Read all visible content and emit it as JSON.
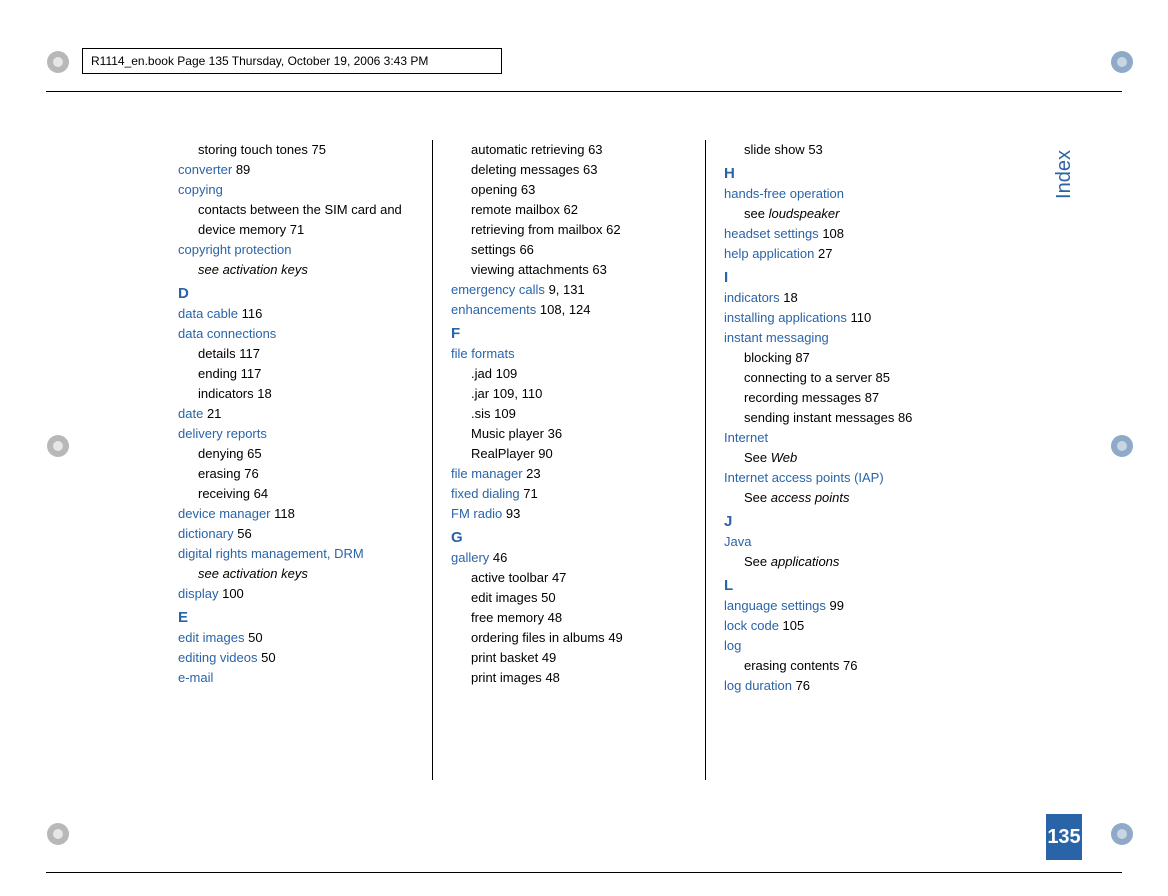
{
  "meta": {
    "crop": "R1114_en.book  Page 135  Thursday, October 19, 2006  3:43 PM",
    "section": "Index",
    "page": "135"
  },
  "col1": {
    "i0": {
      "t": "storing touch tones",
      "p": "75"
    },
    "i1": {
      "t": "converter",
      "p": "89"
    },
    "i2": {
      "t": "copying"
    },
    "i2a": {
      "t": "contacts between the SIM card and device memory",
      "p": "71"
    },
    "i3": {
      "t": "copyright protection"
    },
    "i3a": {
      "t": "see activation keys"
    },
    "D": "D",
    "d1": {
      "t": "data cable",
      "p": "116"
    },
    "d2": {
      "t": "data connections"
    },
    "d2a": {
      "t": "details",
      "p": "117"
    },
    "d2b": {
      "t": "ending",
      "p": "117"
    },
    "d2c": {
      "t": "indicators",
      "p": "18"
    },
    "d3": {
      "t": "date",
      "p": "21"
    },
    "d4": {
      "t": "delivery reports"
    },
    "d4a": {
      "t": "denying",
      "p": "65"
    },
    "d4b": {
      "t": "erasing",
      "p": "76"
    },
    "d4c": {
      "t": "receiving",
      "p": "64"
    },
    "d5": {
      "t": "device manager",
      "p": "118"
    },
    "d6": {
      "t": "dictionary",
      "p": "56"
    },
    "d7": {
      "t": "digital rights management, DRM"
    },
    "d7a": {
      "t": "see activation keys"
    },
    "d8": {
      "t": "display",
      "p": "100"
    },
    "E": "E",
    "e1": {
      "t": "edit images",
      "p": "50"
    },
    "e2": {
      "t": "editing videos",
      "p": "50"
    },
    "e3": {
      "t": "e-mail"
    }
  },
  "col2": {
    "e3a": {
      "t": "automatic retrieving",
      "p": "63"
    },
    "e3b": {
      "t": "deleting messages",
      "p": "63"
    },
    "e3c": {
      "t": "opening",
      "p": "63"
    },
    "e3d": {
      "t": "remote mailbox",
      "p": "62"
    },
    "e3e": {
      "t": "retrieving from mailbox",
      "p": "62"
    },
    "e3f": {
      "t": "settings",
      "p": "66"
    },
    "e3g": {
      "t": "viewing attachments",
      "p": "63"
    },
    "e4": {
      "t": "emergency calls",
      "p": "9, 131"
    },
    "e5": {
      "t": "enhancements",
      "p": "108, 124"
    },
    "F": "F",
    "f1": {
      "t": "file formats"
    },
    "f1a": {
      "t": ".jad",
      "p": "109"
    },
    "f1b": {
      "t": ".jar",
      "p": "109, 110"
    },
    "f1c": {
      "t": ".sis",
      "p": "109"
    },
    "f1d": {
      "t": "Music player",
      "p": "36"
    },
    "f1e": {
      "t": "RealPlayer",
      "p": "90"
    },
    "f2": {
      "t": "file manager",
      "p": "23"
    },
    "f3": {
      "t": "fixed dialing",
      "p": "71"
    },
    "f4": {
      "t": "FM radio",
      "p": "93"
    },
    "G": "G",
    "g1": {
      "t": "gallery",
      "p": "46"
    },
    "g1a": {
      "t": "active toolbar",
      "p": "47"
    },
    "g1b": {
      "t": "edit images",
      "p": "50"
    },
    "g1c": {
      "t": "free memory",
      "p": "48"
    },
    "g1d": {
      "t": "ordering files in albums",
      "p": "49"
    },
    "g1e": {
      "t": "print basket",
      "p": "49"
    },
    "g1f": {
      "t": "print images",
      "p": "48"
    }
  },
  "col3": {
    "g1g": {
      "t": "slide show",
      "p": "53"
    },
    "H": "H",
    "h1": {
      "t": "hands-free operation"
    },
    "h1a": {
      "t1": "see ",
      "t2": "loudspeaker"
    },
    "h2": {
      "t": "headset settings",
      "p": "108"
    },
    "h3": {
      "t": "help application",
      "p": "27"
    },
    "I": "I",
    "i1": {
      "t": "indicators",
      "p": "18"
    },
    "i2": {
      "t": "installing applications",
      "p": "110"
    },
    "i3": {
      "t": "instant messaging"
    },
    "i3a": {
      "t": "blocking",
      "p": "87"
    },
    "i3b": {
      "t": "connecting to a server",
      "p": "85"
    },
    "i3c": {
      "t": "recording messages",
      "p": "87"
    },
    "i3d": {
      "t": "sending instant messages",
      "p": "86"
    },
    "i4": {
      "t": "Internet"
    },
    "i4a": {
      "t1": "See ",
      "t2": "Web"
    },
    "i5": {
      "t": "Internet access points (IAP)"
    },
    "i5a": {
      "t1": "See ",
      "t2": "access points"
    },
    "J": "J",
    "j1": {
      "t": "Java"
    },
    "j1a": {
      "t1": "See ",
      "t2": "applications"
    },
    "L": "L",
    "l1": {
      "t": "language settings",
      "p": "99"
    },
    "l2": {
      "t": "lock code",
      "p": "105"
    },
    "l3": {
      "t": "log"
    },
    "l3a": {
      "t": "erasing contents",
      "p": "76"
    },
    "l4": {
      "t": "log duration",
      "p": "76"
    }
  }
}
